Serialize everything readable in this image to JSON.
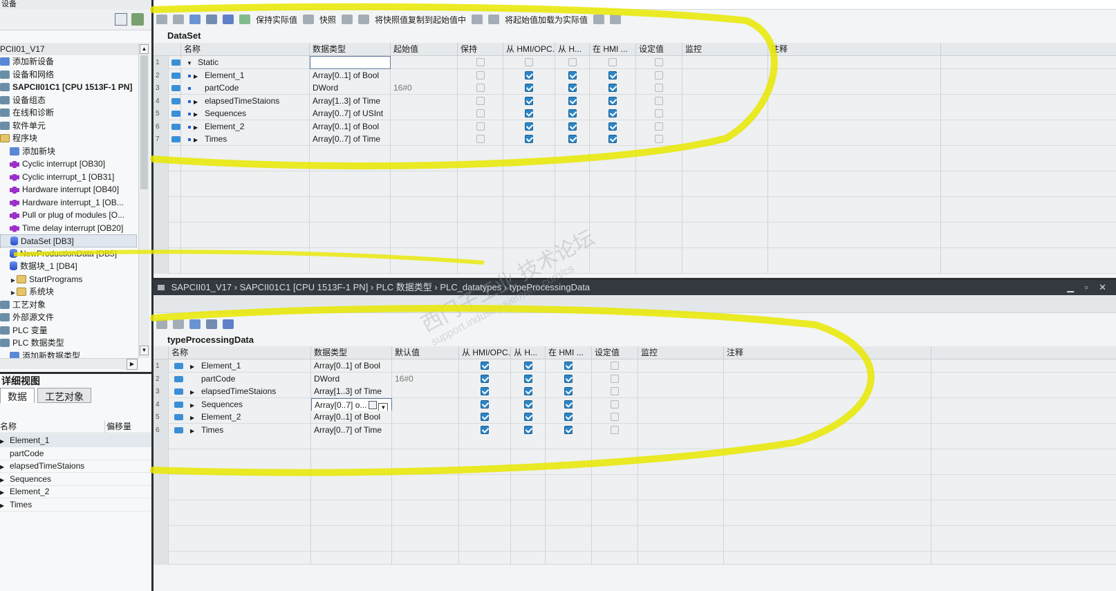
{
  "left": {
    "top_label": "设备",
    "project": "PCII01_V17",
    "tree": [
      {
        "label": "添加新设备",
        "icon": "add-icon",
        "depth": 0
      },
      {
        "label": "设备和网络",
        "icon": "network-icon",
        "depth": 0
      },
      {
        "label": "SAPCII01C1 [CPU 1513F-1 PN]",
        "icon": "cpu-icon",
        "depth": 0,
        "bold": true
      },
      {
        "label": "设备组态",
        "icon": "device-config-icon",
        "depth": 0
      },
      {
        "label": "在线和诊断",
        "icon": "online-icon",
        "depth": 0
      },
      {
        "label": "软件单元",
        "icon": "software-icon",
        "depth": 0
      },
      {
        "label": "程序块",
        "icon": "folder-icon",
        "depth": 0
      },
      {
        "label": "添加新块",
        "icon": "add-block-icon",
        "depth": 1
      },
      {
        "label": "Cyclic interrupt [OB30]",
        "icon": "ob-icon",
        "depth": 1
      },
      {
        "label": "Cyclic interrupt_1 [OB31]",
        "icon": "ob-icon",
        "depth": 1
      },
      {
        "label": "Hardware interrupt [OB40]",
        "icon": "ob-icon",
        "depth": 1
      },
      {
        "label": "Hardware interrupt_1 [OB...",
        "icon": "ob-icon",
        "depth": 1
      },
      {
        "label": "Pull or plug of modules [O...",
        "icon": "ob-icon",
        "depth": 1
      },
      {
        "label": "Time delay interrupt [OB20]",
        "icon": "ob-icon",
        "depth": 1
      },
      {
        "label": "DataSet [DB3]",
        "icon": "db-icon",
        "depth": 1,
        "selected": true
      },
      {
        "label": "NewProductionData [DB5]",
        "icon": "db-icon",
        "depth": 1
      },
      {
        "label": "数据块_1 [DB4]",
        "icon": "db-icon",
        "depth": 1
      },
      {
        "label": "StartPrograms",
        "icon": "folder-icon",
        "depth": 1,
        "expand": true
      },
      {
        "label": "系统块",
        "icon": "folder-icon",
        "depth": 1,
        "expand": true
      },
      {
        "label": "工艺对象",
        "icon": "tech-icon",
        "depth": 0
      },
      {
        "label": "外部源文件",
        "icon": "ext-icon",
        "depth": 0
      },
      {
        "label": "PLC 变量",
        "icon": "tag-icon",
        "depth": 0
      },
      {
        "label": "PLC 数据类型",
        "icon": "type-icon",
        "depth": 0
      },
      {
        "label": "添加新数据类型",
        "icon": "add-icon",
        "depth": 1
      }
    ],
    "detail_title": "详细视图",
    "detail_tabs": [
      "数据",
      "工艺对象"
    ],
    "detail_cols": [
      "名称",
      "偏移量"
    ],
    "detail_rows": [
      {
        "label": "Element_1",
        "expand": true
      },
      {
        "label": "partCode",
        "expand": false
      },
      {
        "label": "elapsedTimeStaions",
        "expand": true
      },
      {
        "label": "Sequences",
        "expand": true
      },
      {
        "label": "Element_2",
        "expand": true
      },
      {
        "label": "Times",
        "expand": true
      }
    ]
  },
  "top": {
    "toolbar": {
      "keep_actual": "保持实际值",
      "snapshot": "快照",
      "copy_snapshot": "将快照值复制到起始值中",
      "load_start": "将起始值加载为实际值"
    },
    "title": "DataSet",
    "columns": [
      "名称",
      "数据类型",
      "起始值",
      "保持",
      "从 HMI/OPC...",
      "从 H...",
      "在 HMI ...",
      "设定值",
      "监控",
      "注释"
    ],
    "rows": [
      {
        "n": "1",
        "name": "Static",
        "type": "",
        "start": "",
        "root": true
      },
      {
        "n": "2",
        "name": "Element_1",
        "type": "Array[0..1] of Bool",
        "start": "",
        "expand": true,
        "c": [
          0,
          1,
          1,
          1,
          0
        ]
      },
      {
        "n": "3",
        "name": "partCode",
        "type": "DWord",
        "start": "16#0",
        "expand": false,
        "c": [
          0,
          1,
          1,
          1,
          0
        ]
      },
      {
        "n": "4",
        "name": "elapsedTimeStaions",
        "type": "Array[1..3] of Time",
        "start": "",
        "expand": true,
        "c": [
          0,
          1,
          1,
          1,
          0
        ]
      },
      {
        "n": "5",
        "name": "Sequences",
        "type": "Array[0..7] of USInt",
        "start": "",
        "expand": true,
        "c": [
          0,
          1,
          1,
          1,
          0
        ]
      },
      {
        "n": "6",
        "name": "Element_2",
        "type": "Array[0..1] of Bool",
        "start": "",
        "expand": true,
        "c": [
          0,
          1,
          1,
          1,
          0
        ]
      },
      {
        "n": "7",
        "name": "Times",
        "type": "Array[0..7] of Time",
        "start": "",
        "expand": true,
        "c": [
          0,
          1,
          1,
          1,
          0
        ]
      }
    ]
  },
  "bottom": {
    "breadcrumb": "SAPCII01_V17  ›  SAPCII01C1 [CPU 1513F-1 PN]  ›  PLC 数据类型  ›  PLC_datatypes  ›  typeProcessingData",
    "title": "typeProcessingData",
    "columns": [
      "名称",
      "数据类型",
      "默认值",
      "从 HMI/OPC...",
      "从 H...",
      "在 HMI ...",
      "设定值",
      "监控",
      "注释"
    ],
    "rows": [
      {
        "n": "1",
        "name": "Element_1",
        "type": "Array[0..1] of Bool",
        "def": "",
        "expand": true
      },
      {
        "n": "2",
        "name": "partCode",
        "type": "DWord",
        "def": "16#0",
        "expand": false
      },
      {
        "n": "3",
        "name": "elapsedTimeStaions",
        "type": "Array[1..3] of Time",
        "def": "",
        "expand": true
      },
      {
        "n": "4",
        "name": "Sequences",
        "type": "Array[0..7] o...",
        "def": "",
        "expand": true,
        "editing": true
      },
      {
        "n": "5",
        "name": "Element_2",
        "type": "Array[0..1] of Bool",
        "def": "",
        "expand": true
      },
      {
        "n": "6",
        "name": "Times",
        "type": "Array[0..7] of Time",
        "def": "",
        "expand": true
      }
    ]
  },
  "watermark": {
    "line1": "西门子工业  技术论坛",
    "line2": "support.industry.siemens.com/cs"
  },
  "colors": {
    "highlight": "#e8e800",
    "check": "#2a86c8"
  }
}
